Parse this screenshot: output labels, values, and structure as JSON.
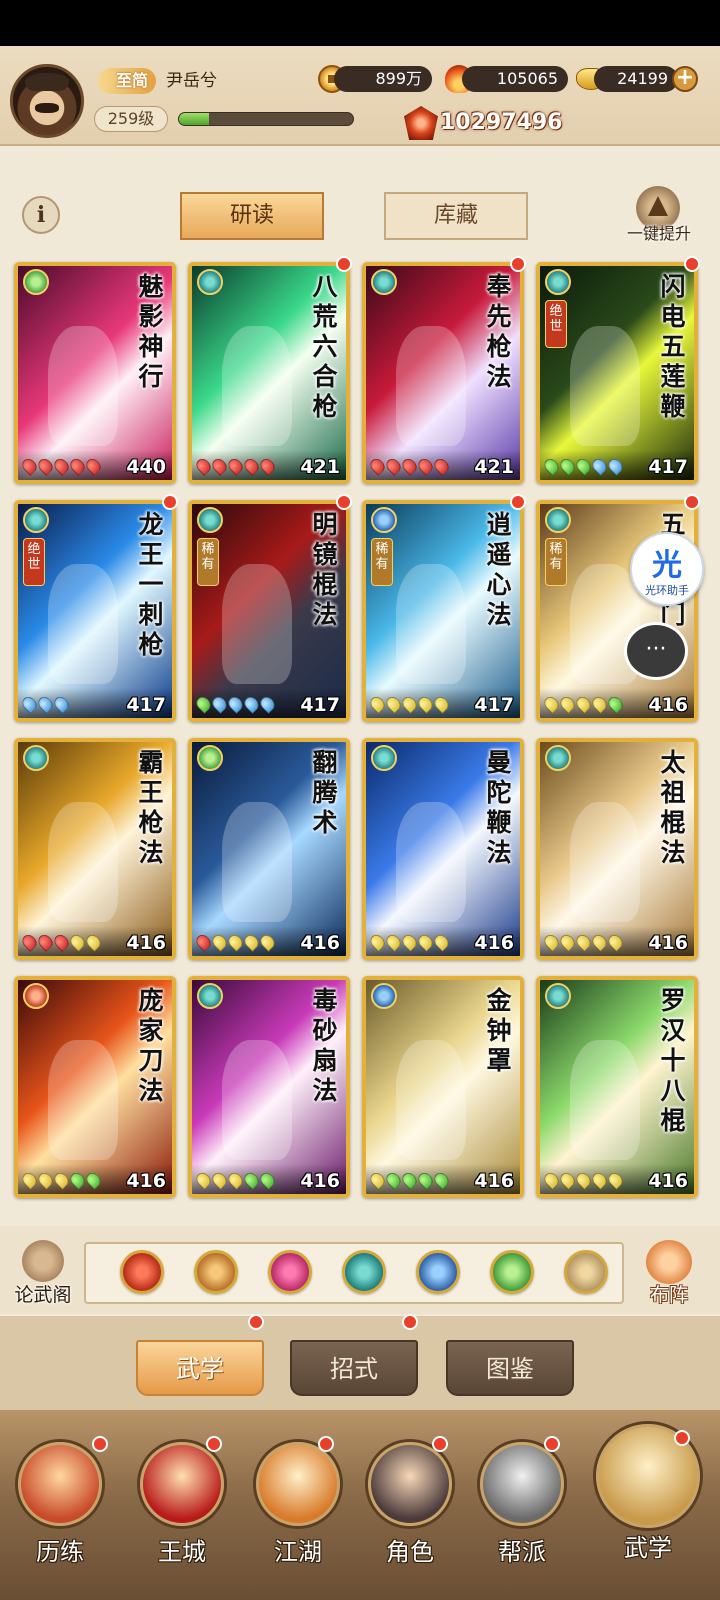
{
  "header": {
    "vip_label": "至简",
    "player_name": "尹岳兮",
    "level": "259级",
    "exp_fraction": 0.17,
    "coins": "899万",
    "flame": "105065",
    "gold": "24199",
    "plus": "+",
    "combat_power": "10297496"
  },
  "subtabs": {
    "info": "i",
    "study": "研读",
    "collection": "库藏",
    "upgrade_all": "一键提升"
  },
  "cards": [
    {
      "name": "魅影神行",
      "level": "440",
      "type_icon": "claw-icon",
      "rarity": "",
      "stars": [
        "r",
        "r",
        "r",
        "r",
        "r"
      ],
      "badge": false,
      "bg": "linear-gradient(135deg,#4a0a2a,#e8387a 45%,#fff0f6 60%,#c81a5a)"
    },
    {
      "name": "八荒六合枪",
      "level": "421",
      "type_icon": "fan-icon",
      "rarity": "",
      "stars": [
        "r",
        "r",
        "r",
        "r",
        "r"
      ],
      "badge": true,
      "bg": "linear-gradient(135deg,#0a3a2a,#3ad88a 40%,#f4fff0 55%,#1a6a4a)"
    },
    {
      "name": "奉先枪法",
      "level": "421",
      "type_icon": "fan-icon",
      "rarity": "",
      "stars": [
        "r",
        "r",
        "r",
        "r",
        "r"
      ],
      "badge": true,
      "bg": "linear-gradient(135deg,#3a0a1a,#c81a3a 40%,#f0e0ff 60%,#5a3aa8)"
    },
    {
      "name": "闪电五莲鞭",
      "level": "417",
      "type_icon": "fan-icon",
      "rarity": "绝世",
      "stars": [
        "g",
        "g",
        "g",
        "b",
        "b"
      ],
      "badge": true,
      "bg": "linear-gradient(135deg,#0a1a0a,#2a4a1a 40%,#e8f83a 55%,#1a2a0a)"
    },
    {
      "name": "龙王一刺枪",
      "level": "417",
      "type_icon": "fan-icon",
      "rarity": "绝世",
      "stars": [
        "b",
        "b",
        "b"
      ],
      "badge": true,
      "bg": "linear-gradient(135deg,#0a1a4a,#2a8ae8 40%,#e0f8ff 55%,#0a3a8a)"
    },
    {
      "name": "明镜棍法",
      "level": "417",
      "type_icon": "fan-icon",
      "rarity": "稀有",
      "stars": [
        "g",
        "b",
        "b",
        "b",
        "b"
      ],
      "badge": true,
      "bg": "linear-gradient(135deg,#2a0a0a,#a81a1a 40%,#3a3a4a 60%,#1a2a4a)"
    },
    {
      "name": "逍遥心法",
      "level": "417",
      "type_icon": "tai-icon",
      "rarity": "稀有",
      "stars": [
        "y",
        "y",
        "y",
        "y",
        "y"
      ],
      "badge": true,
      "bg": "linear-gradient(135deg,#0a3a5a,#4ab8e8 40%,#e8fbff 55%,#1a5a8a)"
    },
    {
      "name": "五虎断门",
      "level": "416",
      "type_icon": "fan-icon",
      "rarity": "稀有",
      "stars": [
        "y",
        "y",
        "y",
        "y",
        "g"
      ],
      "badge": true,
      "bg": "linear-gradient(135deg,#5a3a1a,#e8c87a 40%,#fff8e0 55%,#a87a3a)"
    },
    {
      "name": "霸王枪法",
      "level": "416",
      "type_icon": "fan-icon",
      "rarity": "",
      "stars": [
        "r",
        "r",
        "r",
        "y",
        "y"
      ],
      "badge": false,
      "bg": "linear-gradient(135deg,#5a3a0a,#e8a82a 40%,#fff4d8 55%,#8a5a1a)"
    },
    {
      "name": "翻腾术",
      "level": "416",
      "type_icon": "claw-icon",
      "rarity": "",
      "stars": [
        "r",
        "y",
        "y",
        "y",
        "y"
      ],
      "badge": false,
      "bg": "linear-gradient(135deg,#0a1a3a,#2a5a9a 40%,#a8d8ff 55%,#0a2a5a)"
    },
    {
      "name": "曼陀鞭法",
      "level": "416",
      "type_icon": "fan-icon",
      "rarity": "",
      "stars": [
        "y",
        "y",
        "y",
        "y",
        "y"
      ],
      "badge": false,
      "bg": "linear-gradient(135deg,#0a2a6a,#3a7ae8 40%,#f4f8ff 55%,#1a3a8a)"
    },
    {
      "name": "太祖棍法",
      "level": "416",
      "type_icon": "fan-icon",
      "rarity": "",
      "stars": [
        "y",
        "y",
        "y",
        "y",
        "y"
      ],
      "badge": false,
      "bg": "linear-gradient(135deg,#6a4a1a,#e8c88a 40%,#fff8e8 55%,#a87a3a)"
    },
    {
      "name": "庞家刀法",
      "level": "416",
      "type_icon": "blade-icon",
      "rarity": "",
      "stars": [
        "y",
        "y",
        "y",
        "g",
        "g"
      ],
      "badge": false,
      "bg": "linear-gradient(135deg,#3a0a0a,#e8541a 40%,#ffe0a0 55%,#8a1a0a)"
    },
    {
      "name": "毒砂扇法",
      "level": "416",
      "type_icon": "fan-icon",
      "rarity": "",
      "stars": [
        "y",
        "y",
        "y",
        "g",
        "g"
      ],
      "badge": false,
      "bg": "linear-gradient(135deg,#3a0a3a,#c83ab8 40%,#fff0fa 55%,#6a1a6a)"
    },
    {
      "name": "金钟罩",
      "level": "416",
      "type_icon": "tai-icon",
      "rarity": "",
      "stars": [
        "y",
        "g",
        "g",
        "g",
        "g"
      ],
      "badge": false,
      "bg": "linear-gradient(135deg,#6a5a2a,#e8d48a 40%,#fff8e0 55%,#a88a3a)"
    },
    {
      "name": "罗汉十八棍",
      "level": "416",
      "type_icon": "fan-icon",
      "rarity": "",
      "stars": [
        "y",
        "y",
        "y",
        "y",
        "y"
      ],
      "badge": false,
      "bg": "linear-gradient(135deg,#1a3a1a,#8ad86a 40%,#fff4d0 55%,#4a7a2a)"
    }
  ],
  "floating": {
    "helper_glyph": "光",
    "helper_label": "光环助手",
    "chat": "···"
  },
  "filter": {
    "lunwu": "论武阁",
    "buzhen": "布阵",
    "icons": [
      "blade-filter-icon",
      "sword-filter-icon",
      "fist-filter-icon",
      "fan-filter-icon",
      "tai-filter-icon",
      "claw-filter-icon",
      "upgrade-filter-icon"
    ]
  },
  "main_tabs": [
    "武学",
    "招式",
    "图鉴"
  ],
  "nav": [
    "历练",
    "王城",
    "江湖",
    "角色",
    "帮派",
    "武学"
  ]
}
